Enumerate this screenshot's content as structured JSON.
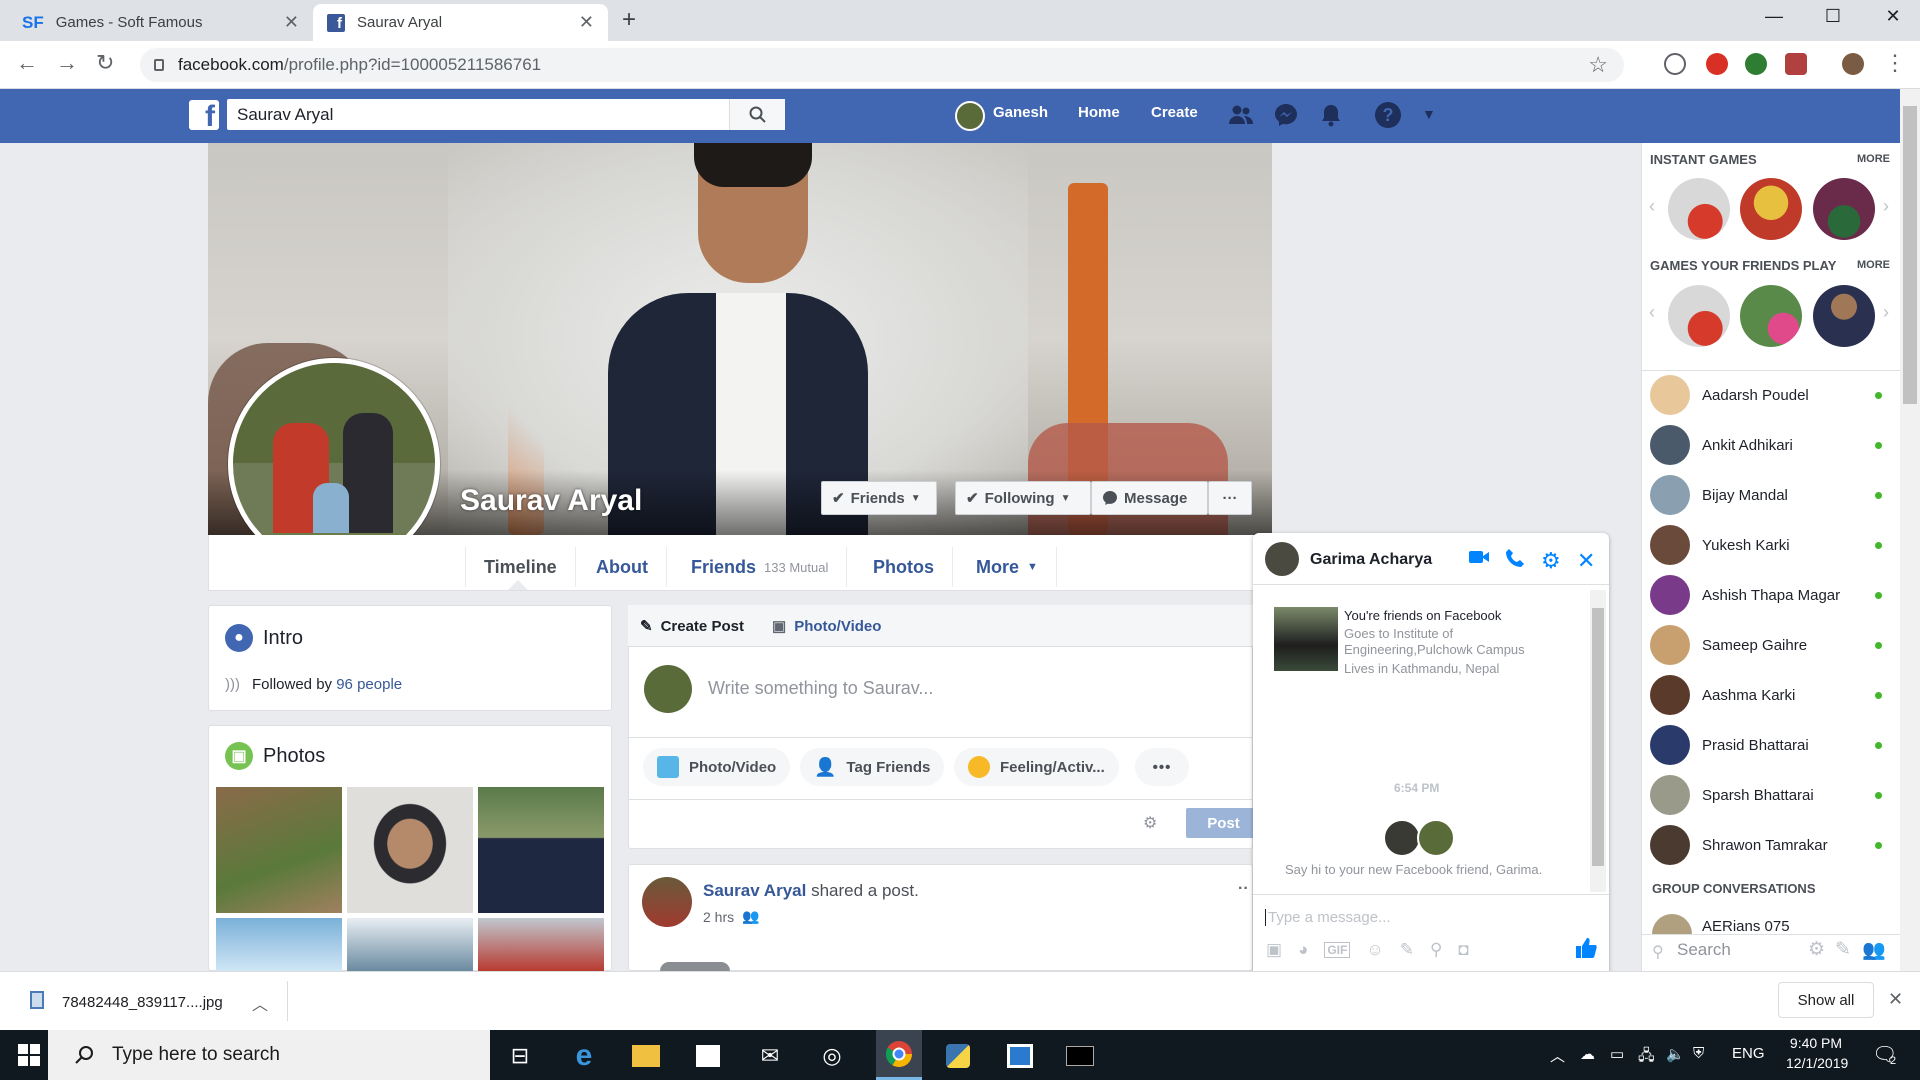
{
  "browser": {
    "tabs": [
      {
        "favicon": "SF",
        "title": "Games - Soft Famous"
      },
      {
        "favicon": "f",
        "title": "Saurav Aryal"
      }
    ],
    "url_domain": "facebook.com",
    "url_path": "/profile.php?id=100005211586761"
  },
  "fb_header": {
    "logo": "f",
    "search_value": "Saurav Aryal",
    "user_name": "Ganesh",
    "nav": [
      "Home",
      "Create"
    ]
  },
  "profile": {
    "name": "Saurav Aryal",
    "buttons": {
      "friends": "Friends",
      "following": "Following",
      "message": "Message",
      "more": "···"
    },
    "tabs": {
      "timeline": "Timeline",
      "about": "About",
      "friends": "Friends",
      "mutual": "133 Mutual",
      "photos": "Photos",
      "more": "More"
    }
  },
  "intro": {
    "title": "Intro",
    "followed_prefix": "Followed by",
    "followed_link": "96 people"
  },
  "photos_card": {
    "title": "Photos"
  },
  "composer": {
    "create_post": "Create Post",
    "photo_video_tab": "Photo/Video",
    "placeholder": "Write something to Saurav...",
    "actions": [
      "Photo/Video",
      "Tag Friends",
      "Feeling/Activ..."
    ],
    "more": "•••",
    "post_button": "Post"
  },
  "feed_post": {
    "author": "Saurav Aryal",
    "action": "shared a post.",
    "time": "2 hrs"
  },
  "chat": {
    "name": "Garima Acharya",
    "friends_line": "You're friends on Facebook",
    "edu": "Goes to Institute of Engineering,Pulchowk Campus",
    "lives": "Lives in Kathmandu, Nepal",
    "time": "6:54 PM",
    "say_hi": "Say hi to your new Facebook friend, Garima.",
    "input_placeholder": "Type a message..."
  },
  "right_sidebar": {
    "instant_games": "INSTANT GAMES",
    "more1": "MORE",
    "friends_play": "GAMES YOUR FRIENDS PLAY",
    "more2": "MORE",
    "contacts": [
      "Aadarsh Poudel",
      "Ankit Adhikari",
      "Bijay Mandal",
      "Yukesh Karki",
      "Ashish Thapa Magar",
      "Sameep Gaihre",
      "Aashma Karki",
      "Prasid Bhattarai",
      "Sparsh Bhattarai",
      "Shrawon Tamrakar"
    ],
    "group_conversations": "GROUP CONVERSATIONS",
    "group": "AERians 075",
    "search_placeholder": "Search"
  },
  "downloads": {
    "file": "78482448_839117....jpg",
    "show_all": "Show all"
  },
  "taskbar": {
    "search_placeholder": "Type here to search",
    "lang": "ENG",
    "time": "9:40 PM",
    "date": "12/1/2019",
    "notifications": "2"
  }
}
